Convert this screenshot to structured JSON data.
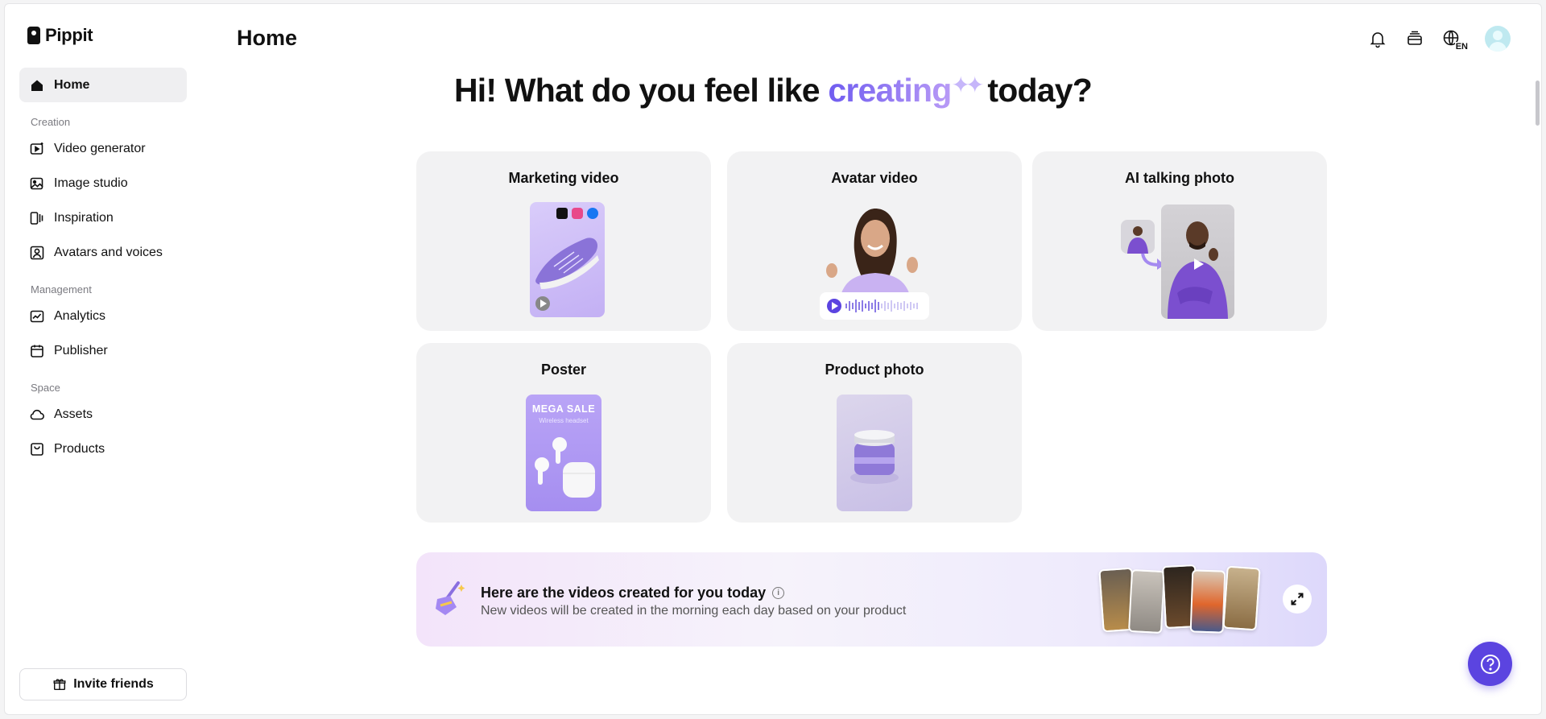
{
  "app": {
    "name": "Pippit"
  },
  "header": {
    "title": "Home",
    "lang": "EN"
  },
  "sidebar": {
    "items": [
      {
        "label": "Home",
        "icon": "home-icon"
      },
      {
        "label": "Video generator",
        "icon": "video-generator-icon"
      },
      {
        "label": "Image studio",
        "icon": "image-studio-icon"
      },
      {
        "label": "Inspiration",
        "icon": "inspiration-icon"
      },
      {
        "label": "Avatars and voices",
        "icon": "avatar-icon"
      },
      {
        "label": "Analytics",
        "icon": "analytics-icon"
      },
      {
        "label": "Publisher",
        "icon": "calendar-icon"
      },
      {
        "label": "Assets",
        "icon": "cloud-icon"
      },
      {
        "label": "Products",
        "icon": "bag-icon"
      }
    ],
    "sections": {
      "creation": "Creation",
      "management": "Management",
      "space": "Space"
    },
    "invite_label": "Invite friends"
  },
  "hero": {
    "before": "Hi! What do you feel like ",
    "accent": "creating",
    "after": "today?"
  },
  "cards": [
    {
      "title": "Marketing video"
    },
    {
      "title": "Avatar video"
    },
    {
      "title": "AI talking photo"
    },
    {
      "title": "Poster",
      "poster_headline": "MEGA SALE",
      "poster_sub": "Wireless headset"
    },
    {
      "title": "Product photo"
    }
  ],
  "banner": {
    "title": "Here are the videos created for you today",
    "subtitle": "New videos will be created in the morning each day based on your product"
  },
  "colors": {
    "accent": "#5b44e0",
    "card_bg": "#f2f2f3",
    "purple": "#a08af0"
  }
}
